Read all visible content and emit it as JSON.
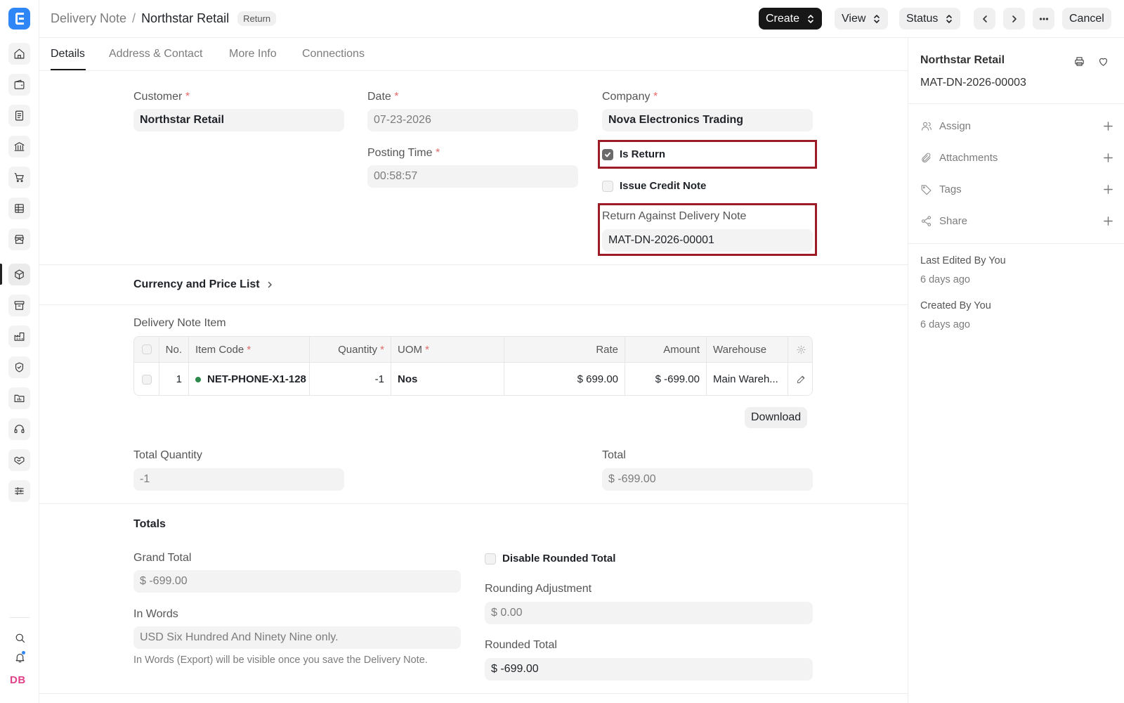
{
  "breadcrumb": {
    "doctype": "Delivery Note",
    "separator": "/",
    "record": "Northstar Retail",
    "status_pill": "Return"
  },
  "header_actions": {
    "create": "Create",
    "view": "View",
    "status": "Status",
    "cancel": "Cancel"
  },
  "tabs": [
    {
      "label": "Details",
      "active": true
    },
    {
      "label": "Address & Contact",
      "active": false
    },
    {
      "label": "More Info",
      "active": false
    },
    {
      "label": "Connections",
      "active": false
    }
  ],
  "form": {
    "customer": {
      "label": "Customer",
      "value": "Northstar Retail"
    },
    "date": {
      "label": "Date",
      "value": "07-23-2026"
    },
    "posting_time": {
      "label": "Posting Time",
      "value": "00:58:57"
    },
    "company": {
      "label": "Company",
      "value": "Nova Electronics Trading"
    },
    "is_return": {
      "label": "Is Return",
      "checked": true
    },
    "issue_credit_note": {
      "label": "Issue Credit Note",
      "checked": false
    },
    "return_against": {
      "label": "Return Against Delivery Note",
      "value": "MAT-DN-2026-00001"
    },
    "required_mark": "*"
  },
  "currency_section": {
    "title": "Currency and Price List"
  },
  "items": {
    "title": "Delivery Note Item",
    "columns": [
      "No.",
      "Item Code",
      "Quantity",
      "UOM",
      "Rate",
      "Amount",
      "Warehouse"
    ],
    "rows": [
      {
        "no": "1",
        "item_code": "NET-PHONE-X1-128",
        "quantity": "-1",
        "uom": "Nos",
        "rate": "$ 699.00",
        "amount": "$ -699.00",
        "warehouse": "Main Wareh..."
      }
    ],
    "download_label": "Download"
  },
  "summary": {
    "total_quantity": {
      "label": "Total Quantity",
      "value": "-1"
    },
    "total": {
      "label": "Total",
      "value": "$ -699.00"
    }
  },
  "totals": {
    "title": "Totals",
    "grand_total": {
      "label": "Grand Total",
      "value": "$ -699.00"
    },
    "in_words": {
      "label": "In Words",
      "value": "USD Six Hundred And Ninety Nine only."
    },
    "in_words_hint": "In Words (Export) will be visible once you save the Delivery Note.",
    "disable_rounded_total": {
      "label": "Disable Rounded Total",
      "checked": false
    },
    "rounding_adjustment": {
      "label": "Rounding Adjustment",
      "value": "$ 0.00"
    },
    "rounded_total": {
      "label": "Rounded Total",
      "value": "$ -699.00"
    }
  },
  "sidebar": {
    "title": "Northstar Retail",
    "doc_id": "MAT-DN-2026-00003",
    "actions": [
      {
        "label": "Assign",
        "icon": "user-icon"
      },
      {
        "label": "Attachments",
        "icon": "paperclip-icon"
      },
      {
        "label": "Tags",
        "icon": "tag-icon"
      },
      {
        "label": "Share",
        "icon": "share-icon"
      }
    ],
    "last_edited": "Last Edited By You",
    "last_edited_when": "6 days ago",
    "created": "Created By You",
    "created_when": "6 days ago"
  },
  "user": {
    "initials": "DB"
  },
  "colors": {
    "accent": "#2f86f6",
    "highlight": "#9b1c24",
    "required": "#e36a6a",
    "avatar": "#e0428a",
    "item_dot": "#2b8a4b"
  }
}
